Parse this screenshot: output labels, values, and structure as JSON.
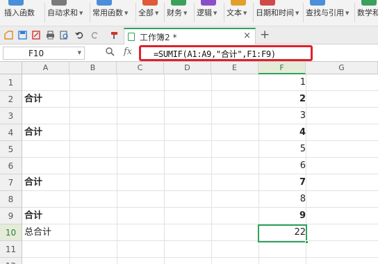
{
  "ribbon": {
    "items": [
      {
        "label": "插入函数",
        "dropdown": false,
        "color": "#4a8fd8"
      },
      {
        "label": "自动求和",
        "dropdown": true,
        "color": "#7a7a7a"
      },
      {
        "label": "常用函数",
        "dropdown": true,
        "color": "#4a8fd8"
      },
      {
        "label": "全部",
        "dropdown": true,
        "color": "#e05a3a"
      },
      {
        "label": "财务",
        "dropdown": true,
        "color": "#3aa05a"
      },
      {
        "label": "逻辑",
        "dropdown": true,
        "color": "#8a4fc8"
      },
      {
        "label": "文本",
        "dropdown": true,
        "color": "#e0a02a"
      },
      {
        "label": "日期和时间",
        "dropdown": true,
        "color": "#d04a4a"
      },
      {
        "label": "查找与引用",
        "dropdown": true,
        "color": "#4a8fd8"
      },
      {
        "label": "数学和",
        "dropdown": false,
        "color": "#3aa05a"
      }
    ]
  },
  "quickbar": {
    "icons": [
      "new-file-icon",
      "save-icon",
      "pdf-export-icon",
      "print-icon",
      "print-preview-icon",
      "undo-icon",
      "redo-icon",
      "format-painter-icon"
    ],
    "tab_label": "工作簿2 *",
    "tab_close": "×",
    "new_tab": "+"
  },
  "formula_bar": {
    "name_box": "F10",
    "fx_label": "fx",
    "formula": "=SUMIF(A1:A9,\"合计\",F1:F9)"
  },
  "sheet": {
    "columns": [
      "A",
      "B",
      "C",
      "D",
      "E",
      "F",
      "G"
    ],
    "active_column": "F",
    "active_row": 10,
    "rows": [
      {
        "num": "1",
        "a": "",
        "f": "1",
        "a_bold": false,
        "f_bold": false
      },
      {
        "num": "2",
        "a": "合计",
        "f": "2",
        "a_bold": true,
        "f_bold": true
      },
      {
        "num": "3",
        "a": "",
        "f": "3",
        "a_bold": false,
        "f_bold": false
      },
      {
        "num": "4",
        "a": "合计",
        "f": "4",
        "a_bold": true,
        "f_bold": true
      },
      {
        "num": "5",
        "a": "",
        "f": "5",
        "a_bold": false,
        "f_bold": false
      },
      {
        "num": "6",
        "a": "",
        "f": "6",
        "a_bold": false,
        "f_bold": false
      },
      {
        "num": "7",
        "a": "合计",
        "f": "7",
        "a_bold": true,
        "f_bold": true
      },
      {
        "num": "8",
        "a": "",
        "f": "8",
        "a_bold": false,
        "f_bold": false
      },
      {
        "num": "9",
        "a": "合计",
        "f": "9",
        "a_bold": true,
        "f_bold": true
      },
      {
        "num": "10",
        "a": "总合计",
        "f": "22",
        "a_bold": false,
        "f_bold": false
      },
      {
        "num": "11",
        "a": "",
        "f": "",
        "a_bold": false,
        "f_bold": false
      },
      {
        "num": "12",
        "a": "",
        "f": "",
        "a_bold": false,
        "f_bold": false
      }
    ]
  }
}
